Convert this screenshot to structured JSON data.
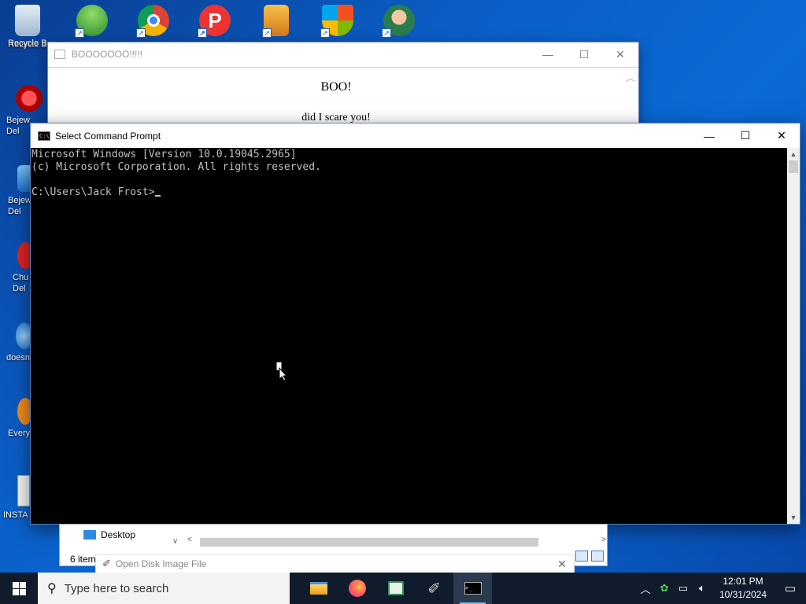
{
  "desktop": {
    "icons": [
      {
        "label": "Recycle B",
        "icon": "recycle-bin-icon"
      },
      {
        "label": "Bejew\nDel",
        "icon": "bejeweled-icon"
      },
      {
        "label": "Bejew\nDel",
        "icon": "bejeweled-icon"
      },
      {
        "label": "Chu\nDel",
        "icon": "chuzzle-icon"
      },
      {
        "label": "doesn",
        "icon": "doesnt-icon"
      },
      {
        "label": "Every",
        "icon": "everything-icon"
      },
      {
        "label": "INSTA",
        "icon": "install-file-icon"
      }
    ]
  },
  "boo_window": {
    "title": "BOOOOOOO!!!!!",
    "heading": "BOO!",
    "text": "did I scare you!"
  },
  "cmd_window": {
    "title": "Select Command Prompt",
    "line1": "Microsoft Windows [Version 10.0.19045.2965]",
    "line2": "(c) Microsoft Corporation. All rights reserved.",
    "prompt": "C:\\Users\\Jack Frost>"
  },
  "explorer": {
    "nav_item": "Desktop",
    "status": "6 item"
  },
  "disk_bar": {
    "title": "Open Disk Image File"
  },
  "taskbar": {
    "search_placeholder": "Type here to search",
    "time": "12:01 PM",
    "date": "10/31/2024"
  },
  "colors": {
    "desktop_blue": "#0b5ec7",
    "taskbar": "#101b2b",
    "console_text": "#c0c0c0"
  }
}
